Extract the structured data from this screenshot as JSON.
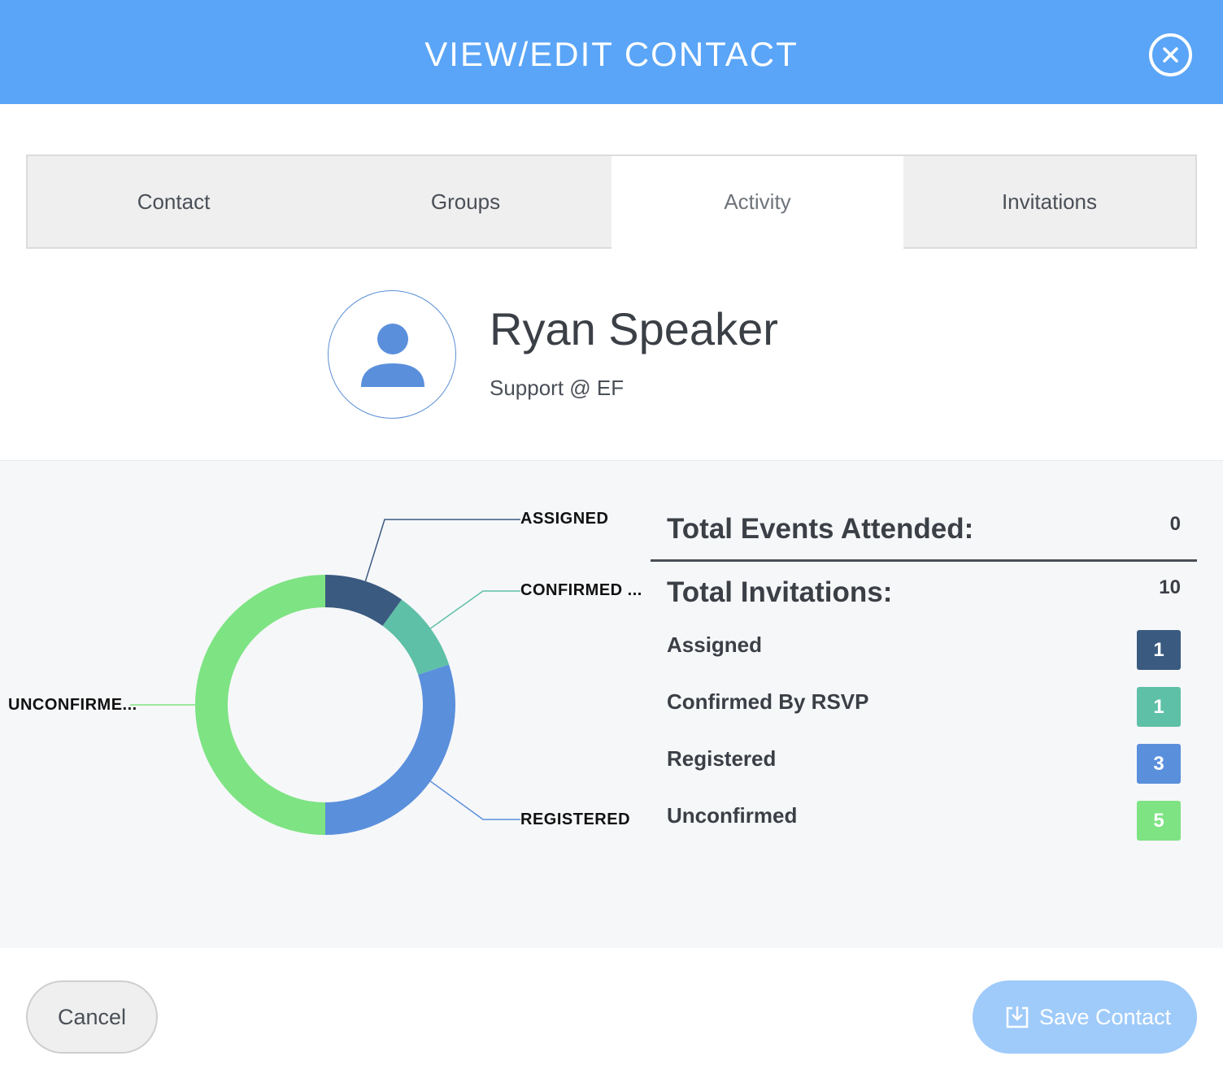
{
  "header": {
    "title": "VIEW/EDIT CONTACT"
  },
  "tabs": [
    {
      "label": "Contact",
      "active": false
    },
    {
      "label": "Groups",
      "active": false
    },
    {
      "label": "Activity",
      "active": true
    },
    {
      "label": "Invitations",
      "active": false
    }
  ],
  "contact": {
    "name": "Ryan Speaker",
    "organization": "Support @ EF"
  },
  "stats": {
    "events_attended_label": "Total Events Attended:",
    "events_attended_value": "0",
    "invitations_label": "Total Invitations:",
    "invitations_value": "10",
    "rows": [
      {
        "label": "Assigned",
        "count": "1",
        "color": "#3a5a80"
      },
      {
        "label": "Confirmed By RSVP",
        "count": "1",
        "color": "#5ec0a7"
      },
      {
        "label": "Registered",
        "count": "3",
        "color": "#5a8fdc"
      },
      {
        "label": "Unconfirmed",
        "count": "5",
        "color": "#7ee383"
      }
    ]
  },
  "chart_data": {
    "type": "pie",
    "donut": true,
    "categories": [
      "ASSIGNED",
      "CONFIRMED ...",
      "REGISTERED",
      "UNCONFIRME..."
    ],
    "values": [
      1,
      1,
      3,
      5
    ],
    "colors": [
      "#3a5a80",
      "#5ec0a7",
      "#5a8fdc",
      "#7ee383"
    ],
    "legend": "none"
  },
  "footer": {
    "cancel_label": "Cancel",
    "save_label": "Save Contact"
  }
}
